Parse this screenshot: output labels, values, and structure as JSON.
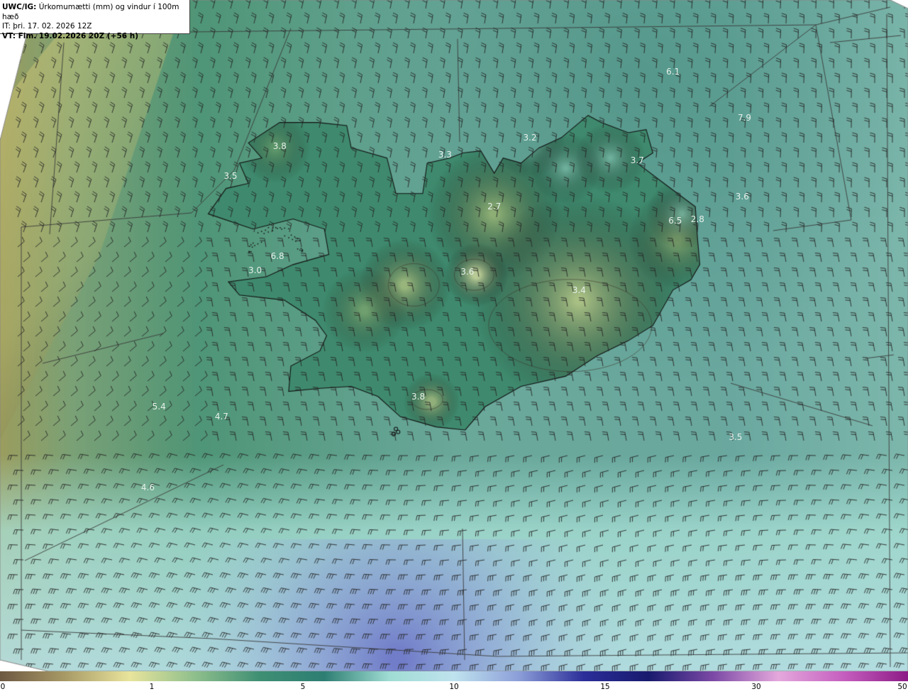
{
  "header": {
    "title_prefix": "UWC/IG:",
    "title": "Úrkomumætti (mm) og vindur í 100m hæð",
    "init_time": "IT: þri. 17. 02. 2026 12Z",
    "valid_time": "VT: Fim. 19.02.2026 20Z (+56 h)"
  },
  "map_labels": [
    {
      "text": "6.1",
      "lon": -14.1,
      "lat": 66.95
    },
    {
      "text": "7.9",
      "lon": -12.5,
      "lat": 66.5
    },
    {
      "text": "3.8",
      "lon": -22.9,
      "lat": 66.22
    },
    {
      "text": "3.5",
      "lon": -24.0,
      "lat": 65.92
    },
    {
      "text": "3.2",
      "lon": -17.3,
      "lat": 66.3
    },
    {
      "text": "3.3",
      "lon": -19.2,
      "lat": 66.13
    },
    {
      "text": "3.7",
      "lon": -14.9,
      "lat": 66.08
    },
    {
      "text": "3.6",
      "lon": -12.55,
      "lat": 65.72
    },
    {
      "text": "2.7",
      "lon": -18.1,
      "lat": 65.62
    },
    {
      "text": "6.5",
      "lon": -14.05,
      "lat": 65.48
    },
    {
      "text": "2.8",
      "lon": -13.55,
      "lat": 65.5
    },
    {
      "text": "6.8",
      "lon": -22.95,
      "lat": 65.13
    },
    {
      "text": "3.0",
      "lon": -23.45,
      "lat": 64.99
    },
    {
      "text": "3.6",
      "lon": -18.7,
      "lat": 64.98
    },
    {
      "text": "3.4",
      "lon": -16.2,
      "lat": 64.8
    },
    {
      "text": "3.8",
      "lon": -19.8,
      "lat": 63.75
    },
    {
      "text": "5.4",
      "lon": -25.6,
      "lat": 63.65
    },
    {
      "text": "4.7",
      "lon": -24.2,
      "lat": 63.55
    },
    {
      "text": "3.5",
      "lon": -12.7,
      "lat": 63.35
    },
    {
      "text": "4.6",
      "lon": -25.85,
      "lat": 62.85
    }
  ],
  "legend": {
    "ticks": [
      "0",
      "1",
      "5",
      "10",
      "15",
      "30",
      "50"
    ],
    "colors": [
      "#6d5842",
      "#a89a66",
      "#e8e49c",
      "#8fbf8c",
      "#3f8f74",
      "#2e7e73",
      "#9fdcd3",
      "#bfe3ee",
      "#8c9ed8",
      "#2b2e99",
      "#181a6e",
      "#7c4aa6",
      "#e4a8dc",
      "#c55fbf",
      "#8d1a86"
    ]
  },
  "map_colors": {
    "ocean_base": "#6aa89a",
    "land_base": "#3f8a6e",
    "coastline": "#111111",
    "grid_lines": "#3a3a3a",
    "wind_barbs": "#262626"
  }
}
